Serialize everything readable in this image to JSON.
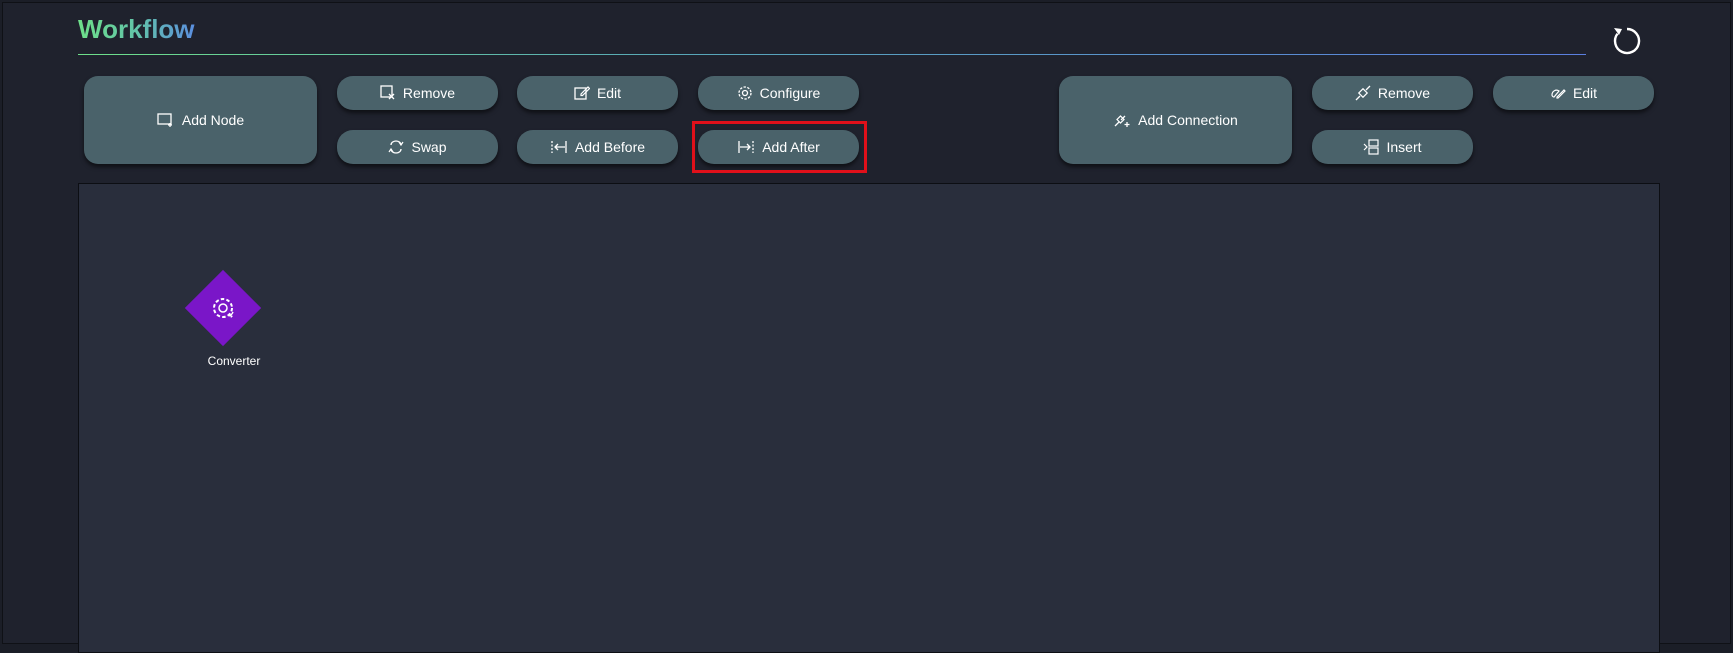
{
  "header": {
    "title": "Workflow",
    "refresh_icon": "refresh-icon"
  },
  "node_toolbar": {
    "add_node": {
      "label": "Add Node",
      "icon": "add-node-icon"
    },
    "remove": {
      "label": "Remove",
      "icon": "remove-node-icon"
    },
    "edit": {
      "label": "Edit",
      "icon": "edit-icon"
    },
    "configure": {
      "label": "Configure",
      "icon": "gear-icon"
    },
    "swap": {
      "label": "Swap",
      "icon": "swap-icon"
    },
    "add_before": {
      "label": "Add Before",
      "icon": "add-before-icon"
    },
    "add_after": {
      "label": "Add After",
      "icon": "add-after-icon",
      "highlighted": true
    }
  },
  "connection_toolbar": {
    "add_connection": {
      "label": "Add Connection",
      "icon": "add-connection-icon"
    },
    "remove": {
      "label": "Remove",
      "icon": "remove-connection-icon"
    },
    "edit": {
      "label": "Edit",
      "icon": "edit-connection-icon"
    },
    "insert": {
      "label": "Insert",
      "icon": "insert-icon"
    }
  },
  "canvas": {
    "nodes": [
      {
        "label": "Converter",
        "icon": "converter-gear-icon",
        "color": "#7a16c8"
      }
    ]
  },
  "colors": {
    "button_bg": "#4a626a",
    "canvas_bg": "#292e3c",
    "highlight": "#e0101a",
    "title_gradient_start": "#6ee08a",
    "title_gradient_end": "#5b8fe0"
  }
}
